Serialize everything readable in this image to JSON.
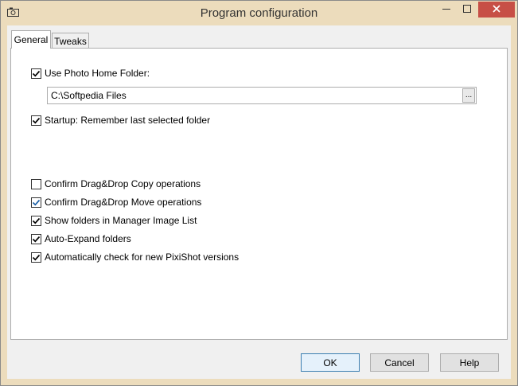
{
  "window": {
    "title": "Program configuration",
    "icons": {
      "app": "camera-icon",
      "minimize": "minimize-icon",
      "maximize": "maximize-icon",
      "close": "close-icon"
    },
    "colors": {
      "frame": "#ecdcbc",
      "close": "#c74f46"
    }
  },
  "tabs": [
    {
      "label": "General",
      "active": true
    },
    {
      "label": "Tweaks",
      "active": false
    }
  ],
  "general": {
    "use_home_folder": {
      "label": "Use Photo Home Folder:",
      "checked": true
    },
    "home_folder_path": {
      "value": "C:\\Softpedia Files"
    },
    "browse_button": {
      "label": "..."
    },
    "startup_remember": {
      "label": "Startup: Remember last selected folder",
      "checked": true
    },
    "confirm_copy": {
      "label": "Confirm Drag&Drop Copy operations",
      "checked": false
    },
    "confirm_move": {
      "label": "Confirm Drag&Drop Move operations",
      "checked": true
    },
    "show_folders": {
      "label": "Show folders in Manager Image List",
      "checked": true
    },
    "auto_expand": {
      "label": "Auto-Expand folders",
      "checked": true
    },
    "auto_check_versions": {
      "label": "Automatically check for new PixiShot versions",
      "checked": true
    }
  },
  "buttons": {
    "ok": "OK",
    "cancel": "Cancel",
    "help": "Help"
  }
}
